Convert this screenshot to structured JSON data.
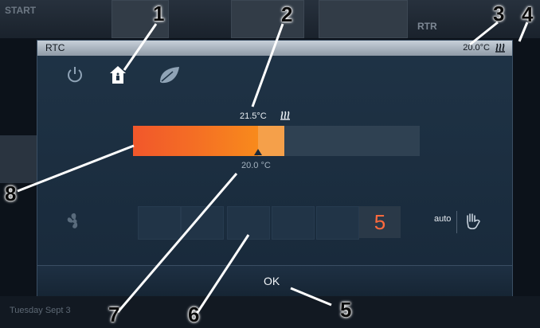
{
  "background": {
    "start_label": "START",
    "rtr_label": "RTR",
    "bottom_text": "Tuesday Sept 3"
  },
  "dialog": {
    "title": "RTC",
    "current_temp": "20.0°C",
    "setpoint": "21.5°C",
    "actual_temp": "20.0 °C",
    "fan_level": "5",
    "auto_label": "auto",
    "ok_label": "OK"
  },
  "bar": {
    "fill_fraction": 0.436,
    "pending_fraction": 0.528
  },
  "colors": {
    "accent": "#f46c25",
    "fan_level": "#ff6a3d",
    "dialog_bg": "#1f3346",
    "titlebar": "#c7d0d9"
  },
  "icons": [
    "power-icon",
    "home-icon",
    "leaf-icon",
    "heat-icon",
    "fan-icon",
    "hand-icon"
  ],
  "callouts": [
    "1",
    "2",
    "3",
    "4",
    "5",
    "6",
    "7",
    "8"
  ]
}
